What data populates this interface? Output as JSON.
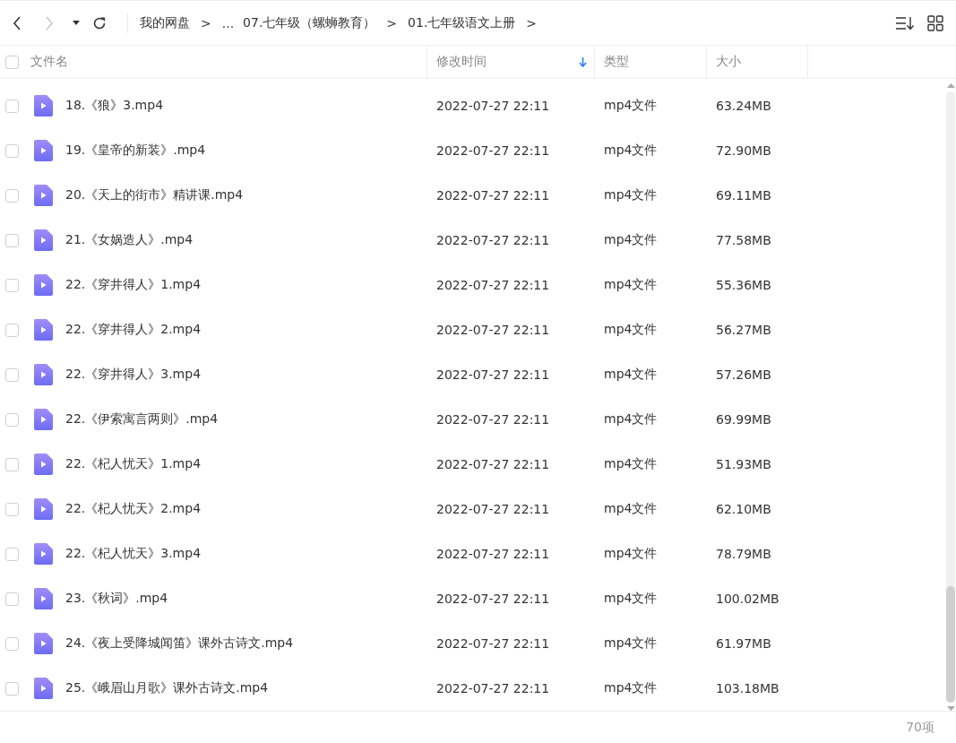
{
  "toolbar": {
    "forward_disabled": true,
    "breadcrumb": [
      {
        "kind": "crumb",
        "text": "我的网盘"
      },
      {
        "kind": "sep",
        "text": ">"
      },
      {
        "kind": "crumb",
        "text": "..."
      },
      {
        "kind": "crumb",
        "text": "07.七年级（螺蛳教育）"
      },
      {
        "kind": "sep",
        "text": ">"
      },
      {
        "kind": "crumb",
        "text": "01.七年级语文上册"
      },
      {
        "kind": "sep",
        "text": ">"
      }
    ]
  },
  "table": {
    "all_checked": false,
    "columns": [
      {
        "label": "文件名",
        "sorted": false
      },
      {
        "label": "修改时间",
        "sorted": true
      },
      {
        "label": "类型",
        "sorted": false
      },
      {
        "label": "大小",
        "sorted": false
      }
    ],
    "rows": [
      {
        "checked": false,
        "name": "18.《狼》3.mp4",
        "modified": "2022-07-27 22:11",
        "type": "mp4文件",
        "size": "63.24MB"
      },
      {
        "checked": false,
        "name": "19.《皇帝的新装》.mp4",
        "modified": "2022-07-27 22:11",
        "type": "mp4文件",
        "size": "72.90MB"
      },
      {
        "checked": false,
        "name": "20.《天上的街市》精讲课.mp4",
        "modified": "2022-07-27 22:11",
        "type": "mp4文件",
        "size": "69.11MB"
      },
      {
        "checked": false,
        "name": "21.《女娲造人》.mp4",
        "modified": "2022-07-27 22:11",
        "type": "mp4文件",
        "size": "77.58MB"
      },
      {
        "checked": false,
        "name": "22.《穿井得人》1.mp4",
        "modified": "2022-07-27 22:11",
        "type": "mp4文件",
        "size": "55.36MB"
      },
      {
        "checked": false,
        "name": "22.《穿井得人》2.mp4",
        "modified": "2022-07-27 22:11",
        "type": "mp4文件",
        "size": "56.27MB"
      },
      {
        "checked": false,
        "name": "22.《穿井得人》3.mp4",
        "modified": "2022-07-27 22:11",
        "type": "mp4文件",
        "size": "57.26MB"
      },
      {
        "checked": false,
        "name": "22.《伊索寓言两则》.mp4",
        "modified": "2022-07-27 22:11",
        "type": "mp4文件",
        "size": "69.99MB"
      },
      {
        "checked": false,
        "name": "22.《杞人忧天》1.mp4",
        "modified": "2022-07-27 22:11",
        "type": "mp4文件",
        "size": "51.93MB"
      },
      {
        "checked": false,
        "name": "22.《杞人忧天》2.mp4",
        "modified": "2022-07-27 22:11",
        "type": "mp4文件",
        "size": "62.10MB"
      },
      {
        "checked": false,
        "name": "22.《杞人忧天》3.mp4",
        "modified": "2022-07-27 22:11",
        "type": "mp4文件",
        "size": "78.79MB"
      },
      {
        "checked": false,
        "name": "23.《秋词》.mp4",
        "modified": "2022-07-27 22:11",
        "type": "mp4文件",
        "size": "100.02MB"
      },
      {
        "checked": false,
        "name": "24.《夜上受降城闻笛》课外古诗文.mp4",
        "modified": "2022-07-27 22:11",
        "type": "mp4文件",
        "size": "61.97MB"
      },
      {
        "checked": false,
        "name": "25.《峨眉山月歌》课外古诗文.mp4",
        "modified": "2022-07-27 22:11",
        "type": "mp4文件",
        "size": "103.18MB"
      }
    ]
  },
  "status_bar": {
    "count": "70项"
  }
}
